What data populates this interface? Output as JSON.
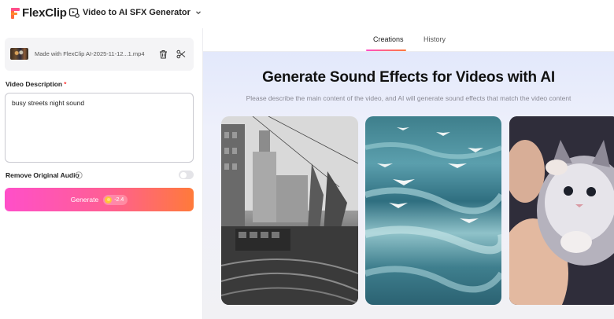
{
  "header": {
    "logo_text": "FlexClip",
    "tool_name": "Video to AI SFX Generator"
  },
  "left_panel": {
    "file_name": "Made with FlexClip AI-2025-11-12...1.mp4",
    "description_label": "Video Description",
    "required_mark": "*",
    "description_value": "busy streets night sound",
    "remove_audio_label": "Remove Original Audio",
    "remove_audio_enabled": false,
    "generate_label": "Generate",
    "credit_cost": "-2.4"
  },
  "right_panel": {
    "tabs": [
      {
        "label": "Creations",
        "active": true
      },
      {
        "label": "History",
        "active": false
      }
    ],
    "title": "Generate Sound Effects for Videos with AI",
    "subtitle": "Please describe the main content of the video, and AI will generate sound effects that match the video content"
  },
  "colors": {
    "accent_start": "#ff4fc9",
    "accent_end": "#ff7a3a",
    "required": "#ff3b3b"
  }
}
